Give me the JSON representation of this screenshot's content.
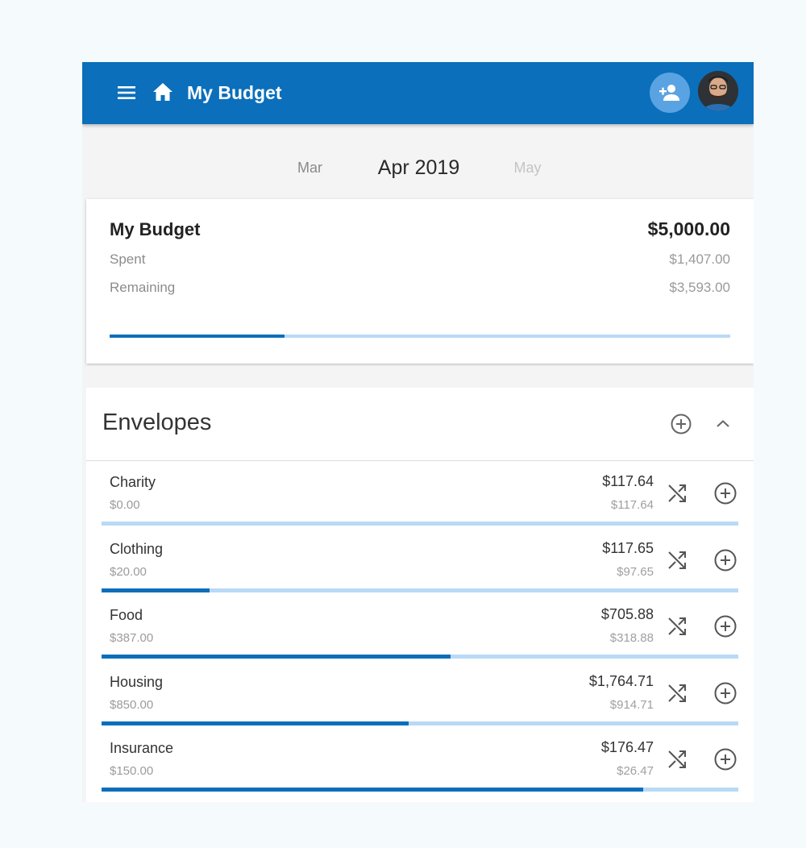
{
  "app": {
    "title": "My Budget"
  },
  "icons": {
    "menu": "menu-icon",
    "home": "home-icon",
    "add_user": "person-add-icon",
    "avatar": "user-avatar",
    "add": "add-circle-icon",
    "collapse": "chevron-up-icon",
    "transfer": "shuffle-icon"
  },
  "colors": {
    "primary": "#0b6fbb",
    "progress_track": "#b9d9f6",
    "accent_button": "#5aa3e2"
  },
  "month_nav": {
    "prev": "Mar",
    "current": "Apr 2019",
    "next": "May"
  },
  "budget": {
    "title": "My Budget",
    "total": "$5,000.00",
    "spent_label": "Spent",
    "spent_value": "$1,407.00",
    "remaining_label": "Remaining",
    "remaining_value": "$3,593.00",
    "progress": 0.2814
  },
  "envelopes": {
    "title": "Envelopes",
    "items": [
      {
        "name": "Charity",
        "spent": "$0.00",
        "budget": "$117.64",
        "remaining": "$117.64",
        "progress": 0.0
      },
      {
        "name": "Clothing",
        "spent": "$20.00",
        "budget": "$117.65",
        "remaining": "$97.65",
        "progress": 0.17
      },
      {
        "name": "Food",
        "spent": "$387.00",
        "budget": "$705.88",
        "remaining": "$318.88",
        "progress": 0.548
      },
      {
        "name": "Housing",
        "spent": "$850.00",
        "budget": "$1,764.71",
        "remaining": "$914.71",
        "progress": 0.482
      },
      {
        "name": "Insurance",
        "spent": "$150.00",
        "budget": "$176.47",
        "remaining": "$26.47",
        "progress": 0.85
      }
    ]
  }
}
